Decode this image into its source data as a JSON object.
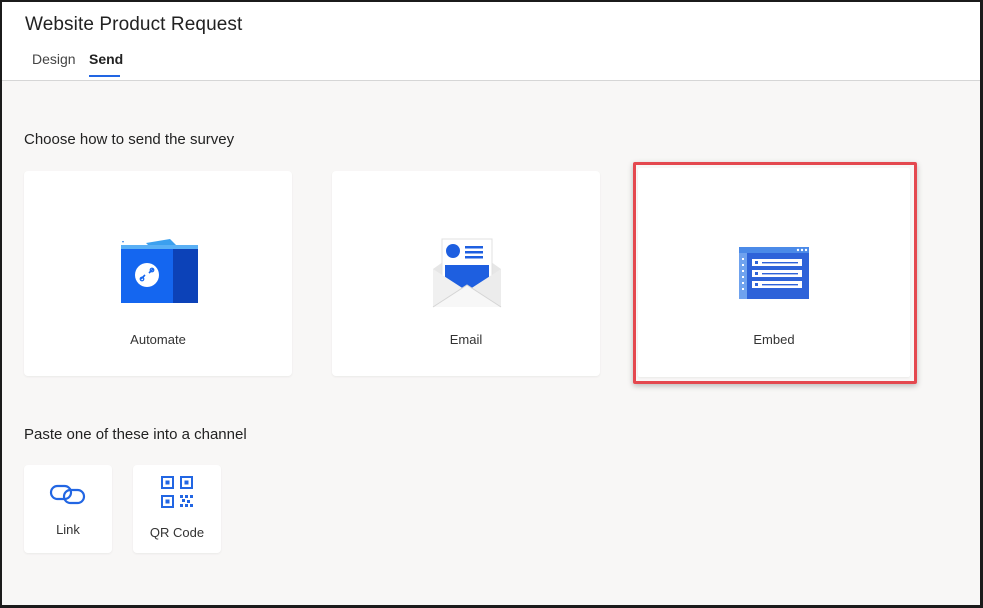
{
  "header": {
    "title": "Website Product Request",
    "tabs": [
      {
        "label": "Design",
        "active": false
      },
      {
        "label": "Send",
        "active": true
      }
    ]
  },
  "send": {
    "heading": "Choose how to send the survey",
    "options": [
      {
        "label": "Automate",
        "icon": "automate-icon"
      },
      {
        "label": "Email",
        "icon": "email-icon"
      },
      {
        "label": "Embed",
        "icon": "embed-icon",
        "highlighted": true
      }
    ]
  },
  "channel": {
    "heading": "Paste one of these into a channel",
    "options": [
      {
        "label": "Link",
        "icon": "link-icon"
      },
      {
        "label": "QR Code",
        "icon": "qr-code-icon"
      }
    ]
  },
  "colors": {
    "accent": "#2266e3",
    "highlight": "#e4484f",
    "background": "#f8f7f6"
  }
}
